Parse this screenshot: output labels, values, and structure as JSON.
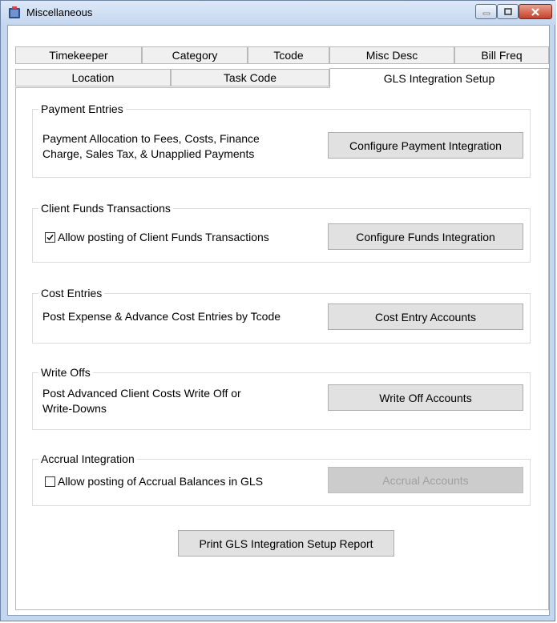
{
  "window": {
    "title": "Miscellaneous"
  },
  "tabs_row1": [
    "Timekeeper",
    "Category",
    "Tcode",
    "Misc Desc",
    "Bill Freq"
  ],
  "tabs_row2": [
    "Location",
    "Task Code",
    "GLS Integration Setup"
  ],
  "groups": {
    "payment": {
      "title": "Payment Entries",
      "desc_line1": "Payment Allocation to Fees, Costs, Finance",
      "desc_line2": "Charge, Sales Tax, & Unapplied Payments",
      "button": "Configure Payment Integration"
    },
    "funds": {
      "title": "Client Funds Transactions",
      "checkbox_label": "Allow posting of Client Funds Transactions",
      "checked": true,
      "button": "Configure Funds Integration"
    },
    "cost": {
      "title": "Cost Entries",
      "desc": "Post Expense & Advance Cost Entries by Tcode",
      "button": "Cost Entry Accounts"
    },
    "writeoffs": {
      "title": "Write Offs",
      "desc_line1": "Post Advanced Client Costs Write Off or",
      "desc_line2": "Write-Downs",
      "button": "Write Off Accounts"
    },
    "accrual": {
      "title": "Accrual Integration",
      "checkbox_label": "Allow posting of Accrual Balances in GLS",
      "checked": false,
      "button": "Accrual Accounts",
      "button_disabled": true
    }
  },
  "report_button": "Print GLS Integration Setup Report",
  "colors": {
    "titlebar": "#c4d6ef",
    "close_button": "#c5412a",
    "button_face": "#e1e1e1",
    "disabled_button": "#cccccc"
  },
  "icons": {
    "app": "app-icon",
    "minimize": "minimize-icon",
    "maximize": "maximize-icon",
    "close": "close-icon",
    "check": "check-icon"
  }
}
